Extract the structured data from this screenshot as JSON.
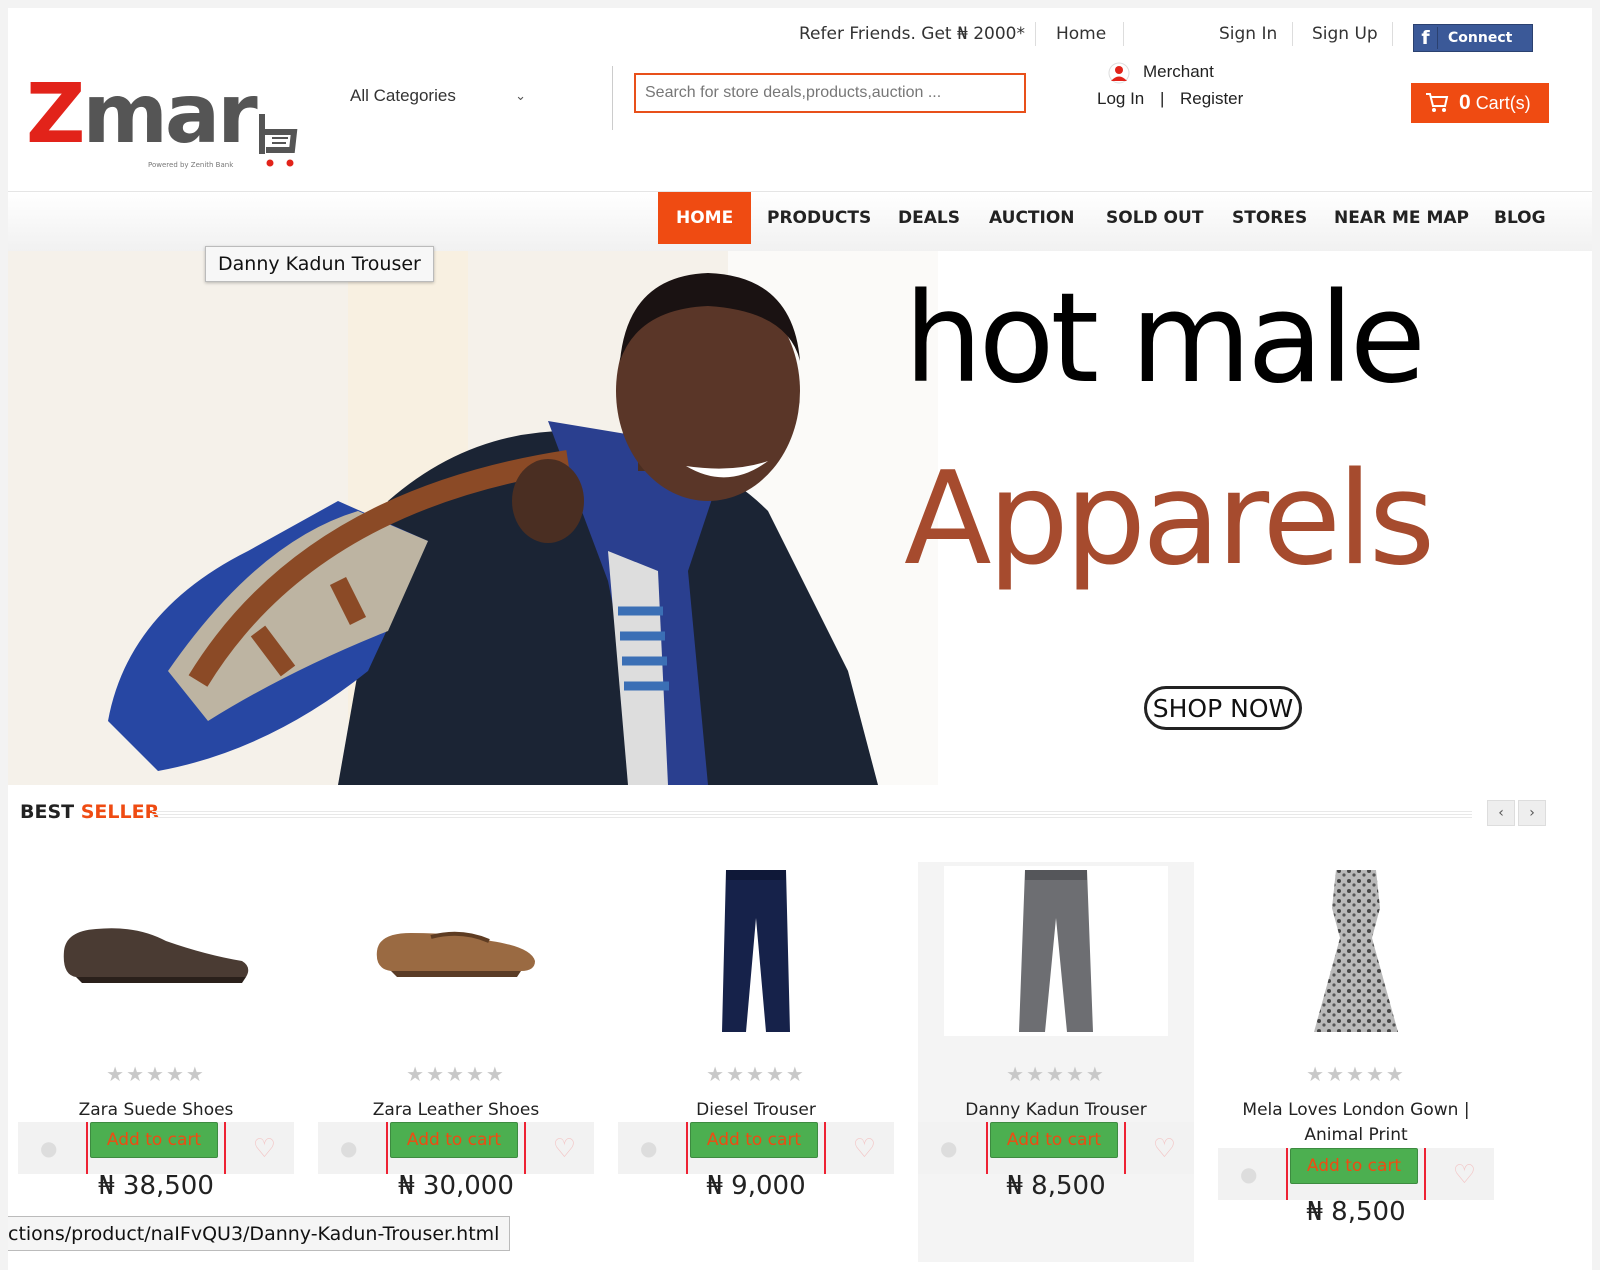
{
  "brand": {
    "logo_z": "Z",
    "logo_rest": "mar",
    "tagline": "Powered by Zenith Bank",
    "colors": {
      "accent": "#ef4b12",
      "logo_red": "#e2231a",
      "facebook": "#3b5998",
      "add_to_cart_green": "#4caf50"
    }
  },
  "header": {
    "category_select": "All Categories",
    "search_placeholder": "Search for store deals,products,auction ...",
    "refer": "Refer Friends. Get ₦ 2000*",
    "home": "Home",
    "sign_in": "Sign In",
    "sign_up": "Sign Up",
    "facebook_connect": "Connect",
    "merchant_label": "Merchant",
    "login": "Log In",
    "login_sep": "|",
    "register": "Register",
    "cart_count": "0",
    "cart_label": "Cart(s)"
  },
  "nav": {
    "items": [
      {
        "label": "HOME",
        "active": true
      },
      {
        "label": "PRODUCTS",
        "active": false
      },
      {
        "label": "DEALS",
        "active": false
      },
      {
        "label": "AUCTION",
        "active": false
      },
      {
        "label": "SOLD OUT",
        "active": false
      },
      {
        "label": "STORES",
        "active": false
      },
      {
        "label": "NEAR ME MAP",
        "active": false
      },
      {
        "label": "BLOG",
        "active": false
      }
    ]
  },
  "tooltip": "Danny Kadun Trouser",
  "hero": {
    "line1": "hot male",
    "line2": "Apparels",
    "cta": "SHOP NOW"
  },
  "best_seller": {
    "title_a": "BEST ",
    "title_b": "SELLER",
    "prev": "‹",
    "next": "›",
    "products": [
      {
        "name": "Zara Suede Shoes",
        "price": "₦ 38,500",
        "add": "Add to cart",
        "rating": "★★★★★"
      },
      {
        "name": "Zara Leather Shoes",
        "price": "₦ 30,000",
        "add": "Add to cart",
        "rating": "★★★★★"
      },
      {
        "name": "Diesel Trouser",
        "price": "₦ 9,000",
        "add": "Add to cart",
        "rating": "★★★★★"
      },
      {
        "name": "Danny Kadun Trouser",
        "price": "₦ 8,500",
        "add": "Add to cart",
        "rating": "★★★★★"
      },
      {
        "name": "Mela Loves London Gown | Animal Print",
        "price": "₦ 8,500",
        "add": "Add to cart",
        "rating": "★★★★★"
      }
    ]
  },
  "status_url": "ctions/product/naIFvQU3/Danny-Kadun-Trouser.html"
}
